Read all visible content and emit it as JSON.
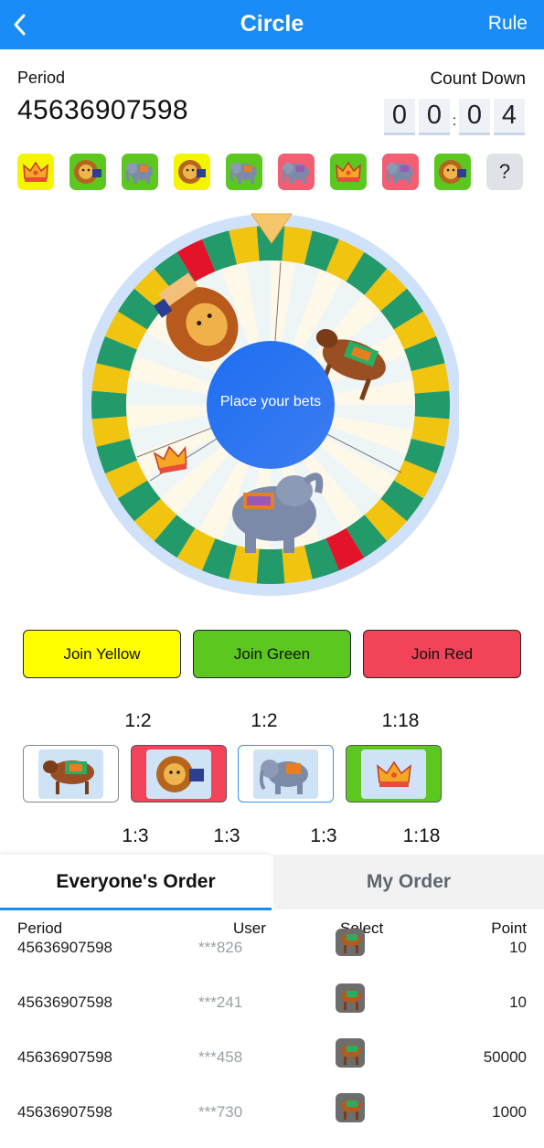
{
  "header": {
    "title": "Circle",
    "rule_label": "Rule",
    "back_icon": "chevron-left-icon"
  },
  "period": {
    "label": "Period",
    "value": "45636907598"
  },
  "countdown": {
    "label": "Count Down",
    "digits": [
      "0",
      "0",
      "0",
      "4"
    ],
    "separator": ":"
  },
  "history": [
    {
      "animal": "crown",
      "color": "yellow"
    },
    {
      "animal": "lion",
      "color": "green"
    },
    {
      "animal": "elephant",
      "color": "green"
    },
    {
      "animal": "lion",
      "color": "yellow"
    },
    {
      "animal": "elephant",
      "color": "green"
    },
    {
      "animal": "elephant",
      "color": "red"
    },
    {
      "animal": "crown",
      "color": "green"
    },
    {
      "animal": "elephant",
      "color": "red"
    },
    {
      "animal": "lion",
      "color": "green"
    },
    {
      "animal": "unknown",
      "color": "grey",
      "text": "?"
    }
  ],
  "wheel": {
    "center_text": "Place your bets",
    "pointer_icon": "pointer-triangle-icon"
  },
  "join_buttons": {
    "yellow": "Join Yellow",
    "green": "Join Green",
    "red": "Join Red"
  },
  "odds_top": [
    "1:2",
    "1:2",
    "1:18"
  ],
  "odds_bottom": [
    "1:3",
    "1:3",
    "1:3",
    "1:18"
  ],
  "bet_options": [
    {
      "animal": "cow",
      "style": "outline-grey"
    },
    {
      "animal": "lion",
      "style": "red"
    },
    {
      "animal": "elephant",
      "style": "outline-blue"
    },
    {
      "animal": "crown",
      "style": "green"
    }
  ],
  "tabs": {
    "everyone": "Everyone's Order",
    "mine": "My Order"
  },
  "table": {
    "headers": {
      "period": "Period",
      "user": "User",
      "select": "Select",
      "point": "Point"
    },
    "rows": [
      {
        "period": "45636907598",
        "user": "***826",
        "select": "cow",
        "point": "10"
      },
      {
        "period": "45636907598",
        "user": "***241",
        "select": "cow",
        "point": "10"
      },
      {
        "period": "45636907598",
        "user": "***458",
        "select": "cow",
        "point": "50000"
      },
      {
        "period": "45636907598",
        "user": "***730",
        "select": "cow",
        "point": "1000"
      }
    ]
  },
  "colors": {
    "header_blue": "#1a8cf8",
    "yellow": "#ffff00",
    "green": "#5cc81f",
    "red": "#f34359",
    "wheel_green": "#229a6a",
    "wheel_yellow": "#f1c40f",
    "wheel_red": "#e3142a"
  }
}
